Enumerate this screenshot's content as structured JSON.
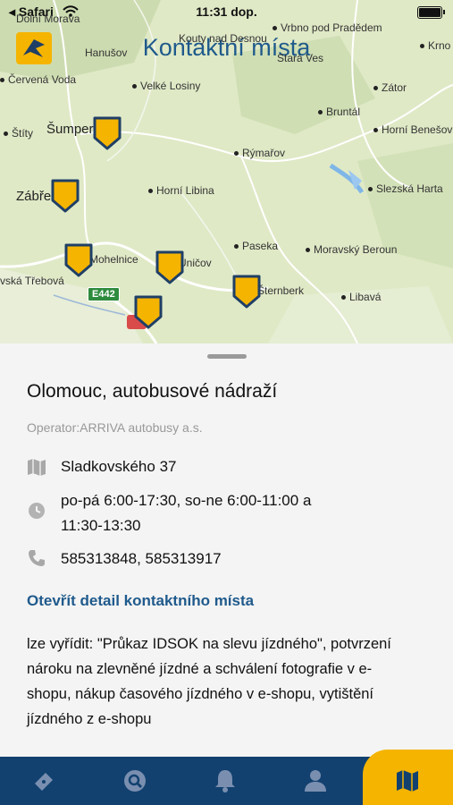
{
  "status_bar": {
    "carrier": "◂ Safari",
    "time": "11:31 dop."
  },
  "header": {
    "title": "Kontaktní místa"
  },
  "map": {
    "places": {
      "dolni_morava": "Dolní Morava",
      "kouty": "Kouty nad Desnou",
      "vrbno": "Vrbno pod Pradědem",
      "krnov": "Krno",
      "hanusovice": "Hanušov",
      "stara_ves": "Stará Ves",
      "cervena_voda": "Červená Voda",
      "velke_losiny": "Velké Losiny",
      "zator": "Zátor",
      "sumperk": "Šumperk",
      "bruntal": "Bruntál",
      "stity": "Štíty",
      "horni_benesov": "Horní Benešov",
      "rymarov": "Rýmařov",
      "zabreh": "Zábřeh",
      "horni_libina": "Horní Libina",
      "slezska_harta": "Slezská Harta",
      "paseka": "Paseka",
      "moravsky_beroun": "Moravský Beroun",
      "mohelnice": "Mohelnice",
      "unicov": "Uničov",
      "ceska_trebova": "vská Třebová",
      "sternberk": "Šternberk",
      "libava": "Libavá"
    },
    "road_badge": "E442"
  },
  "contact_point": {
    "name": "Olomouc, autobusové nádraží",
    "operator": "Operator:ARRIVA autobusy a.s.",
    "address": "Sladkovského 37",
    "hours": "po-pá 6:00-17:30, so-ne 6:00-11:00 a 11:30-13:30",
    "phone": "585313848, 585313917",
    "detail_link": "Otevřít detail kontaktního místa",
    "description": "lze vyřídit: \"Průkaz IDSOK na slevu jízdného\", potvrzení nároku na zlevněné jízdné a schválení fotografie v e-shopu, nákup časového jízdného v e-shopu, vytištění jízdného z e-shopu"
  },
  "icons": {
    "address": "map-icon",
    "hours": "clock-icon",
    "phone": "phone-icon"
  },
  "tabs": [
    {
      "icon": "ticket-icon",
      "active": false
    },
    {
      "icon": "search-icon",
      "active": false
    },
    {
      "icon": "bell-icon",
      "active": false
    },
    {
      "icon": "user-icon",
      "active": false
    },
    {
      "icon": "map-icon",
      "active": true
    }
  ],
  "colors": {
    "accent_blue": "#1f5a8c",
    "tabbar": "#124170",
    "pin_yellow": "#f5b400",
    "active_tab": "#f5b400"
  }
}
